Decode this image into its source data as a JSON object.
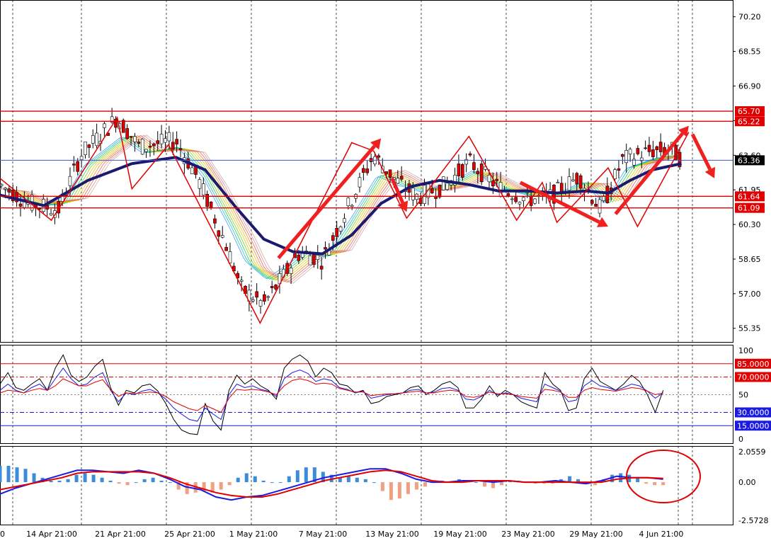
{
  "chart_data": [
    {
      "type": "line",
      "panel": "price",
      "y_ticks": [
        "70.20",
        "68.55",
        "66.90",
        "65.25",
        "63.60",
        "61.95",
        "60.30",
        "58.65",
        "57.00",
        "55.35"
      ],
      "ylim": [
        54.7,
        71.0
      ],
      "hlines": [
        {
          "value": 65.7,
          "label": "65.70",
          "color": "#e00000"
        },
        {
          "value": 65.22,
          "label": "65.22",
          "color": "#e00000"
        },
        {
          "value": 63.36,
          "label": "63.36",
          "color": "#3c5ac8",
          "tag_bg": "#000000"
        },
        {
          "value": 61.64,
          "label": "61.64",
          "color": "#e00000"
        },
        {
          "value": 61.09,
          "label": "61.09",
          "color": "#e00000"
        }
      ],
      "price_path": [
        [
          0,
          62.2
        ],
        [
          0.04,
          61.3
        ],
        [
          0.08,
          61.0
        ],
        [
          0.11,
          63.6
        ],
        [
          0.16,
          65.4
        ],
        [
          0.19,
          64.0
        ],
        [
          0.24,
          64.3
        ],
        [
          0.27,
          62.5
        ],
        [
          0.31,
          59.2
        ],
        [
          0.33,
          57.2
        ],
        [
          0.36,
          56.5
        ],
        [
          0.38,
          57.5
        ],
        [
          0.41,
          59.0
        ],
        [
          0.44,
          58.6
        ],
        [
          0.47,
          60.8
        ],
        [
          0.51,
          63.6
        ],
        [
          0.54,
          62.4
        ],
        [
          0.57,
          61.6
        ],
        [
          0.61,
          62.2
        ],
        [
          0.64,
          63.3
        ],
        [
          0.68,
          62.1
        ],
        [
          0.72,
          61.5
        ],
        [
          0.75,
          61.6
        ],
        [
          0.79,
          62.6
        ],
        [
          0.82,
          61.0
        ],
        [
          0.85,
          63.4
        ],
        [
          0.89,
          63.8
        ],
        [
          0.915,
          63.9
        ],
        [
          0.93,
          63.4
        ]
      ],
      "ma_slow": [
        [
          0,
          61.7
        ],
        [
          0.06,
          61.2
        ],
        [
          0.12,
          62.4
        ],
        [
          0.18,
          63.2
        ],
        [
          0.24,
          63.5
        ],
        [
          0.28,
          62.9
        ],
        [
          0.32,
          61.2
        ],
        [
          0.36,
          59.6
        ],
        [
          0.4,
          59.0
        ],
        [
          0.44,
          58.9
        ],
        [
          0.48,
          59.8
        ],
        [
          0.52,
          61.3
        ],
        [
          0.56,
          62.1
        ],
        [
          0.6,
          62.4
        ],
        [
          0.64,
          62.2
        ],
        [
          0.68,
          61.9
        ],
        [
          0.72,
          61.9
        ],
        [
          0.76,
          61.8
        ],
        [
          0.8,
          61.9
        ],
        [
          0.83,
          61.8
        ],
        [
          0.86,
          62.4
        ],
        [
          0.89,
          62.9
        ],
        [
          0.93,
          63.2
        ]
      ],
      "zigzag": [
        [
          0,
          62.5
        ],
        [
          0.07,
          60.5
        ],
        [
          0.16,
          65.4
        ],
        [
          0.18,
          62.0
        ],
        [
          0.23,
          64.1
        ],
        [
          0.355,
          55.6
        ],
        [
          0.48,
          64.2
        ],
        [
          0.51,
          63.8
        ],
        [
          0.555,
          60.6
        ],
        [
          0.64,
          64.5
        ],
        [
          0.705,
          60.5
        ],
        [
          0.74,
          62.3
        ],
        [
          0.76,
          60.4
        ],
        [
          0.83,
          63.0
        ],
        [
          0.87,
          60.2
        ],
        [
          0.94,
          64.7
        ]
      ],
      "arrows": [
        {
          "from": [
            0.38,
            58.7
          ],
          "to": [
            0.52,
            64.4
          ]
        },
        {
          "from": [
            0.535,
            62.5
          ],
          "to": [
            0.555,
            60.9
          ]
        },
        {
          "from": [
            0.71,
            62.3
          ],
          "to": [
            0.83,
            60.2
          ]
        },
        {
          "from": [
            0.84,
            60.8
          ],
          "to": [
            0.94,
            65.0
          ]
        },
        {
          "from": [
            0.945,
            64.6
          ],
          "to": [
            0.975,
            62.5
          ]
        }
      ]
    },
    {
      "type": "line",
      "panel": "oscillator",
      "y_ticks": [
        "100",
        "50",
        "0"
      ],
      "ylim": [
        0,
        100
      ],
      "levels": [
        {
          "value": 85,
          "label": "85.0000",
          "color": "#e00000",
          "bg": "#e00000"
        },
        {
          "value": 70,
          "label": "70.0000",
          "color": "#e00000",
          "bg": "#e00000"
        },
        {
          "value": 30,
          "label": "30.0000",
          "color": "#1a1ae0",
          "bg": "#1a1ae0"
        },
        {
          "value": 15,
          "label": "15.0000",
          "color": "#1a1ae0",
          "bg": "#1a1ae0"
        }
      ],
      "series": [
        {
          "color": "#000000",
          "values": [
            62,
            75,
            58,
            55,
            62,
            68,
            55,
            80,
            95,
            72,
            65,
            70,
            82,
            90,
            58,
            38,
            55,
            52,
            60,
            62,
            54,
            40,
            22,
            10,
            6,
            5,
            40,
            20,
            10,
            55,
            72,
            62,
            68,
            60,
            55,
            45,
            80,
            90,
            95,
            88,
            70,
            80,
            75,
            62,
            60,
            52,
            55,
            40,
            42,
            48,
            50,
            52,
            58,
            60,
            50,
            55,
            62,
            65,
            58,
            35,
            35,
            45,
            60,
            48,
            55,
            50,
            42,
            38,
            35,
            75,
            62,
            55,
            32,
            35,
            68,
            80,
            65,
            60,
            55,
            62,
            72,
            65,
            50,
            30,
            55
          ]
        },
        {
          "color": "#1a1ae0",
          "values": [
            55,
            62,
            55,
            52,
            58,
            62,
            55,
            68,
            80,
            68,
            60,
            62,
            70,
            75,
            55,
            42,
            52,
            50,
            54,
            56,
            52,
            45,
            35,
            28,
            22,
            20,
            35,
            28,
            22,
            50,
            62,
            58,
            60,
            56,
            54,
            48,
            68,
            75,
            78,
            74,
            65,
            68,
            66,
            58,
            56,
            52,
            54,
            46,
            48,
            50,
            51,
            52,
            55,
            56,
            52,
            53,
            57,
            58,
            55,
            45,
            44,
            48,
            55,
            50,
            52,
            50,
            46,
            44,
            42,
            62,
            58,
            54,
            42,
            44,
            60,
            66,
            60,
            58,
            55,
            58,
            62,
            60,
            54,
            46,
            52
          ]
        },
        {
          "color": "#e00000",
          "values": [
            52,
            55,
            54,
            52,
            55,
            57,
            55,
            60,
            68,
            64,
            60,
            60,
            64,
            67,
            56,
            48,
            52,
            51,
            52,
            53,
            52,
            48,
            42,
            38,
            34,
            32,
            38,
            34,
            30,
            46,
            56,
            55,
            56,
            55,
            53,
            50,
            60,
            66,
            68,
            66,
            62,
            63,
            62,
            57,
            55,
            53,
            53,
            49,
            50,
            51,
            51,
            52,
            53,
            54,
            52,
            52,
            54,
            55,
            54,
            48,
            47,
            49,
            53,
            51,
            51,
            50,
            48,
            47,
            46,
            56,
            55,
            53,
            47,
            47,
            55,
            58,
            56,
            55,
            54,
            56,
            58,
            57,
            54,
            50,
            52
          ]
        }
      ]
    },
    {
      "type": "bar",
      "panel": "macd",
      "y_ticks": [
        "2.0559",
        "0.00",
        "-2.5728"
      ],
      "ylim": [
        -2.5728,
        2.0559
      ],
      "histogram": [
        1.1,
        1.1,
        1.0,
        0.9,
        0.6,
        0.3,
        0.1,
        0.1,
        0.2,
        0.5,
        0.6,
        0.5,
        0.3,
        0.1,
        -0.1,
        -0.2,
        0.0,
        0.2,
        0.3,
        0.1,
        0.0,
        -0.5,
        -0.8,
        -0.7,
        -0.6,
        -0.7,
        -0.5,
        -0.2,
        0.3,
        0.6,
        0.4,
        0.1,
        0.0,
        0.0,
        0.4,
        0.8,
        1.0,
        1.0,
        0.7,
        0.5,
        0.3,
        0.4,
        0.3,
        0.2,
        0.0,
        -0.6,
        -1.2,
        -1.1,
        -0.8,
        -0.5,
        -0.3,
        0.0,
        0.1,
        0.0,
        0.2,
        0.1,
        0.0,
        -0.3,
        -0.4,
        -0.2,
        0.1,
        0.1,
        0.0,
        -0.1,
        -0.1,
        -0.1,
        0.2,
        0.4,
        0.2,
        -0.1,
        -0.2,
        0.2,
        0.5,
        0.6,
        0.5,
        0.3,
        -0.1,
        -0.2,
        -0.2
      ],
      "series": [
        {
          "color": "#1a1ae0",
          "values": [
            -0.8,
            -0.4,
            -0.1,
            0.2,
            0.5,
            0.8,
            0.8,
            0.7,
            0.6,
            0.8,
            0.6,
            0.2,
            -0.3,
            -0.5,
            -1.0,
            -1.2,
            -1.0,
            -0.9,
            -0.6,
            -0.3,
            0.0,
            0.3,
            0.5,
            0.7,
            0.9,
            0.9,
            0.6,
            0.2,
            0.0,
            0.0,
            0.1,
            0.1,
            0.0,
            0.1,
            0.0,
            0.0,
            0.1,
            0.0,
            -0.1,
            0.1,
            0.4,
            0.3,
            0.3,
            0.2
          ]
        },
        {
          "color": "#e00000",
          "values": [
            -0.5,
            -0.3,
            -0.1,
            0.1,
            0.3,
            0.6,
            0.7,
            0.7,
            0.7,
            0.7,
            0.6,
            0.3,
            -0.1,
            -0.4,
            -0.7,
            -0.9,
            -1.0,
            -1.0,
            -0.8,
            -0.5,
            -0.2,
            0.1,
            0.3,
            0.5,
            0.7,
            0.8,
            0.7,
            0.4,
            0.1,
            0.0,
            0.0,
            0.1,
            0.1,
            0.1,
            0.0,
            0.0,
            0.0,
            0.0,
            0.0,
            0.0,
            0.2,
            0.3,
            0.3,
            0.25
          ]
        }
      ],
      "annotation": "circle"
    }
  ],
  "x_tick_labels": [
    "0",
    "14 Apr 21:00",
    "21 Apr 21:00",
    "25 Apr 21:00",
    "1 May 21:00",
    "7 May 21:00",
    "13 May 21:00",
    "19 May 21:00",
    "23 May 21:00",
    "29 May 21:00",
    "4 Jun 21:00"
  ]
}
